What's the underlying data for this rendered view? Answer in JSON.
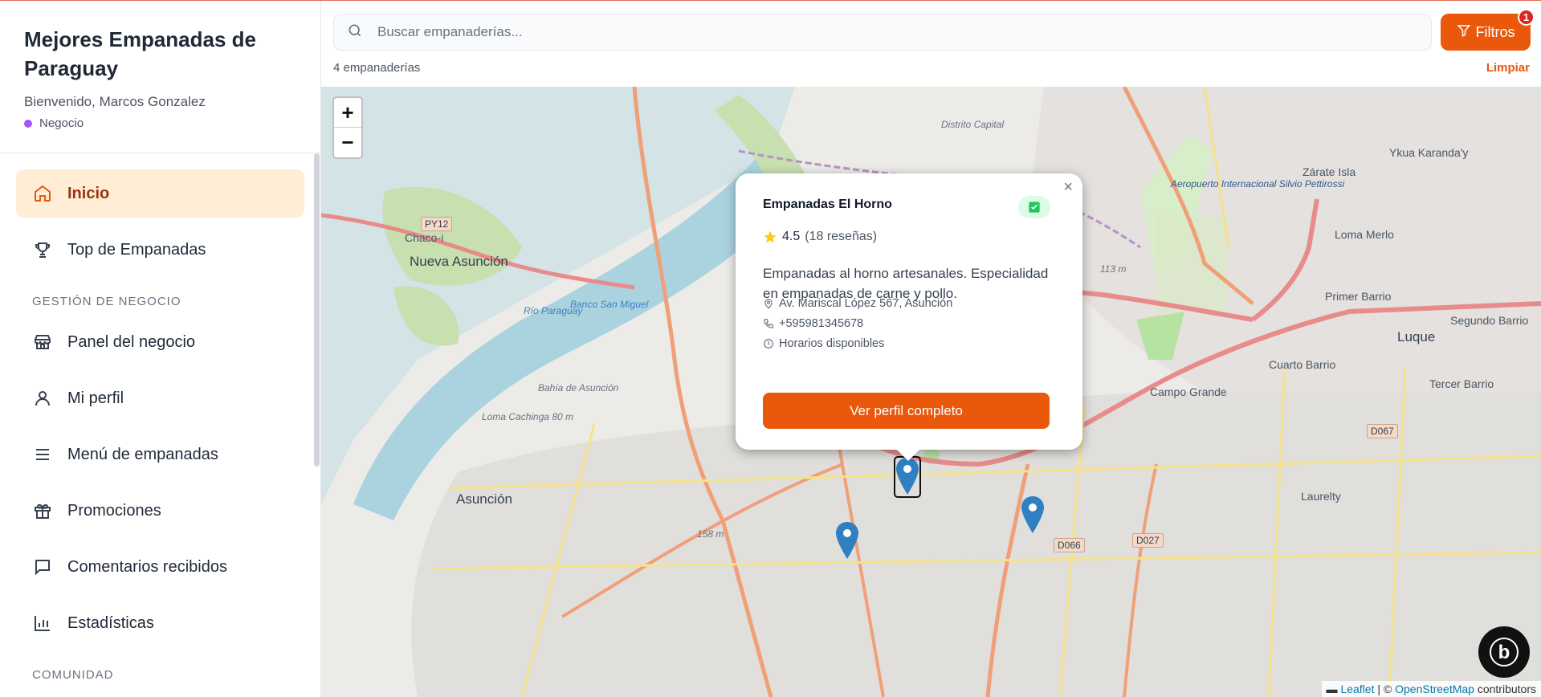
{
  "sidebar": {
    "title": "Mejores Empanadas de Paraguay",
    "welcome": "Bienvenido, Marcos Gonzalez",
    "role": "Negocio",
    "role_color": "#a855f7",
    "items": [
      {
        "label": "Inicio",
        "icon": "home-icon",
        "active": true
      },
      {
        "label": "Top de Empanadas",
        "icon": "trophy-icon"
      }
    ],
    "section_business": "GESTIÓN DE NEGOCIO",
    "business_items": [
      {
        "label": "Panel del negocio",
        "icon": "store-icon"
      },
      {
        "label": "Mi perfil",
        "icon": "user-icon"
      },
      {
        "label": "Menú de empanadas",
        "icon": "menu-icon"
      },
      {
        "label": "Promociones",
        "icon": "gift-icon"
      },
      {
        "label": "Comentarios recibidos",
        "icon": "comment-icon"
      },
      {
        "label": "Estadísticas",
        "icon": "chart-icon"
      }
    ],
    "section_community": "COMUNIDAD"
  },
  "search": {
    "placeholder": "Buscar empanaderías...",
    "value": ""
  },
  "filters": {
    "label": "Filtros",
    "badge": "1"
  },
  "results": {
    "count": "4 empanaderías",
    "clear": "Limpiar"
  },
  "map": {
    "zoom_in": "+",
    "zoom_out": "−",
    "labels": {
      "asuncion": "Asunción",
      "nueva_asuncion": "Nueva Asunción",
      "chaco_i": "Chaco-i",
      "luque": "Luque",
      "campo_grande": "Campo Grande",
      "zarate_isla": "Zárate Isla",
      "loma_merlo": "Loma Merlo",
      "primer_barrio": "Primer Barrio",
      "segundo_barrio": "Segundo Barrio",
      "cuarto_barrio": "Cuarto Barrio",
      "tercer_barrio": "Tercer Barrio",
      "ykua_karanday": "Ykua Karanda'y",
      "laurelty": "Laurelty",
      "ruta": "PY12",
      "d067": "D067",
      "d066": "D066",
      "d027": "D027",
      "aeropuerto": "Aeropuerto Internacional Silvio Pettirossi",
      "loma_cachinga": "Loma Cachinga 80 m",
      "m113": "113 m",
      "m158": "158 m",
      "distrito": "Distrito Capital",
      "rio_paraguay": "Río Paraguay",
      "banco": "Banco San Miguel",
      "bahia": "Bahía de Asunción"
    },
    "attribution": {
      "leaflet": "Leaflet",
      "sep": " | © ",
      "osm": "OpenStreetMap",
      "rest": " contributors"
    }
  },
  "popup": {
    "name": "Empanadas El Horno",
    "rating": "4.5",
    "reviews": "(18 reseñas)",
    "description": "Empanadas al horno artesanales. Especialidad en empanadas de carne y pollo.",
    "address": "Av. Mariscal López 567, Asunción",
    "phone": "+595981345678",
    "hours": "Horarios disponibles",
    "button": "Ver perfil completo",
    "close": "×"
  },
  "colors": {
    "accent": "#ea580c",
    "active_bg": "#ffedd5",
    "marker": "#3b82c4"
  }
}
